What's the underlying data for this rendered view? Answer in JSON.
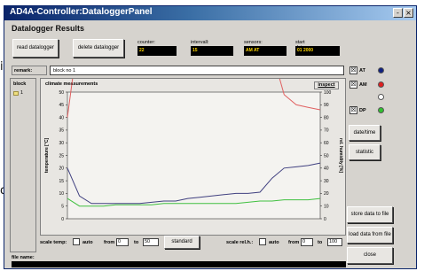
{
  "window": {
    "title": "AD4A-Controller:DataloggerPanel",
    "minimize": "-",
    "close": "×"
  },
  "background_text": {
    "left_1": "it",
    "left_2": "d"
  },
  "panel_title": "Datalogger Results",
  "buttons": {
    "read_datalogger": "read datalogger",
    "delete_datalogger": "delete datalogger",
    "date_time": "date/time",
    "statistic": "statistic",
    "store_data": "store data to file",
    "load_data": "load data from file",
    "close": "close",
    "standard": "standard",
    "inspect": "inspect"
  },
  "fields": {
    "counter": {
      "label": "counter:",
      "value": "22"
    },
    "intervall": {
      "label": "intervall:",
      "value": "15"
    },
    "sensors": {
      "label": "sensors:",
      "value": "AM AT"
    },
    "start_date": {
      "label": "start date:",
      "value": "01 2000"
    }
  },
  "remark": {
    "label": "remark:",
    "value": "block no 1"
  },
  "block": {
    "label": "block",
    "items": [
      "1"
    ]
  },
  "chart_data": {
    "type": "line",
    "title": "climate measurements",
    "ylabel_left": "temperature [°C]",
    "ylabel_right": "rel. humidity [%]",
    "left_ticks": [
      "50",
      "45",
      "40",
      "35",
      "30",
      "25",
      "20",
      "15",
      "10",
      "5",
      "0"
    ],
    "right_ticks": [
      "100",
      "90",
      "80",
      "70",
      "60",
      "50",
      "40",
      "30",
      "20",
      "10",
      "0"
    ],
    "ylim_left": [
      0,
      50
    ],
    "ylim_right": [
      0,
      100
    ],
    "grid": false,
    "x_points": 22,
    "series": [
      {
        "values": [
          40,
          76,
          88,
          88,
          88,
          88,
          88,
          88,
          88,
          87,
          86,
          85,
          84,
          83,
          82,
          80,
          79,
          66,
          49,
          45,
          44,
          43
        ],
        "color": "#e06060"
      },
      {
        "values": [
          20,
          9,
          6,
          6,
          6,
          6,
          6,
          6.5,
          7,
          7,
          8,
          8.5,
          9,
          9.5,
          10,
          10,
          10.5,
          16,
          20,
          20.5,
          21,
          22
        ],
        "color": "#404080"
      },
      {
        "values": [
          8,
          5,
          5,
          5,
          5.5,
          5.5,
          5.5,
          5.5,
          6,
          6,
          6,
          6,
          6,
          6,
          6,
          6.5,
          7,
          7,
          7.5,
          7.5,
          7.5,
          8
        ],
        "color": "#40c040"
      }
    ]
  },
  "legend": [
    {
      "label": "AT",
      "checked": "☒",
      "color": "#102080"
    },
    {
      "label": "AM",
      "checked": "☒",
      "color": "#e02020"
    },
    {
      "label": "",
      "checked": "",
      "color": "#ffffff"
    },
    {
      "label": "DP",
      "checked": "☒",
      "color": "#30c030"
    }
  ],
  "scale_temp": {
    "label": "scale temp:",
    "auto": "auto",
    "from_label": "from",
    "from": "0",
    "to_label": "to",
    "to": "50"
  },
  "scale_rh": {
    "label": "scale rel.h.:",
    "auto": "auto",
    "from_label": "from",
    "from": "0",
    "to_label": "to",
    "to": "100"
  },
  "filename": {
    "label": "file name:",
    "value": ""
  }
}
